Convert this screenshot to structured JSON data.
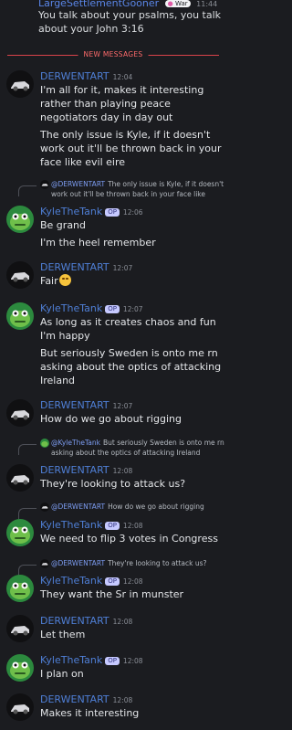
{
  "top": {
    "name": "LargeSettlementGooner",
    "badge": "War",
    "time": "11:44",
    "text": "You talk about your psalms, you talk about your John 3:16"
  },
  "divider": "NEW MESSAGES",
  "messages": [
    {
      "name": "DERWENTART",
      "time": "12:04",
      "lines": [
        "I'm all for it, makes it interesting rather than playing peace negotiators day in day out",
        "The only issue is Kyle, if it doesn't work out it'll be thrown back in your face like evil eire"
      ]
    },
    {
      "reply": {
        "mention": "@DERWENTART",
        "text": "The only issue is Kyle, if it doesn't work out it'll be thrown back in your face like"
      },
      "name": "KyleTheTank",
      "op": "OP",
      "time": "12:06",
      "lines": [
        "Be grand",
        "I'm the heel remember"
      ]
    },
    {
      "name": "DERWENTART",
      "time": "12:07",
      "lines": [
        "Fair"
      ]
    },
    {
      "name": "KyleTheTank",
      "op": "OP",
      "time": "12:07",
      "lines": [
        "As long as it creates chaos and fun I'm happy",
        "But seriously Sweden is onto me rn asking about the optics of attacking Ireland"
      ]
    },
    {
      "name": "DERWENTART",
      "time": "12:07",
      "lines": [
        "How do we go about rigging"
      ]
    },
    {
      "reply": {
        "mention": "@KyleTheTank",
        "text": "But seriously Sweden is onto me rn asking about the optics of attacking Ireland"
      },
      "name": "DERWENTART",
      "time": "12:08",
      "lines": [
        "They're looking to attack us?"
      ]
    },
    {
      "reply": {
        "mention": "@DERWENTART",
        "text": "How do we go about rigging"
      },
      "name": "KyleTheTank",
      "op": "OP",
      "time": "12:08",
      "lines": [
        "We need to flip 3 votes in Congress"
      ]
    },
    {
      "reply": {
        "mention": "@DERWENTART",
        "text": "They're looking to attack us?"
      },
      "name": "KyleTheTank",
      "op": "OP",
      "time": "12:08",
      "lines": [
        "They want the Sr in munster"
      ]
    },
    {
      "name": "DERWENTART",
      "time": "12:08",
      "lines": [
        "Let them"
      ]
    },
    {
      "name": "KyleTheTank",
      "op": "OP",
      "time": "12:08",
      "lines": [
        "I plan on"
      ]
    },
    {
      "name": "DERWENTART",
      "time": "12:08",
      "lines": [
        "Makes it interesting"
      ]
    }
  ],
  "icons": {
    "derw_avatar": "car-avatar-icon",
    "kyle_avatar": "frog-avatar-icon",
    "emoji": "grin-emoji-icon"
  }
}
